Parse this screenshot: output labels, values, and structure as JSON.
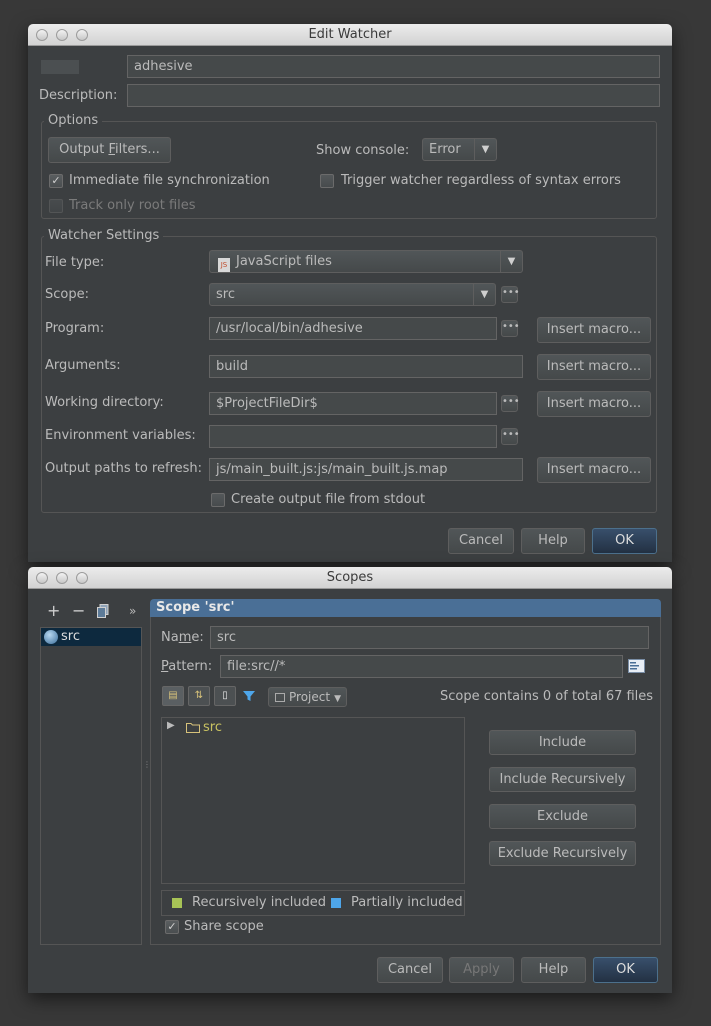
{
  "watcher": {
    "title": "Edit Watcher",
    "name_value": "adhesive",
    "description_label": "Description:",
    "description_value": "",
    "options": {
      "title": "Options",
      "output_filters_pre": "Output ",
      "output_filters_u": "F",
      "output_filters_post": "ilters...",
      "show_console_label": "Show console:",
      "show_console_value": "Error",
      "immediate_sync_label": "Immediate file synchronization",
      "trigger_label": "Trigger watcher regardless of syntax errors",
      "track_root_label": "Track only root files"
    },
    "settings": {
      "title": "Watcher Settings",
      "file_type_label": "File type:",
      "file_type_value": "JavaScript files",
      "file_type_icon_text": "JS",
      "scope_label": "Scope:",
      "scope_value": "src",
      "program_label": "Program:",
      "program_value": "/usr/local/bin/adhesive",
      "arguments_label": "Arguments:",
      "arguments_value": "build",
      "working_dir_label": "Working directory:",
      "working_dir_value": "$ProjectFileDir$",
      "env_label": "Environment variables:",
      "env_value": "",
      "output_paths_label": "Output paths to refresh:",
      "output_paths_value": "js/main_built.js:js/main_built.js.map",
      "insert_macro_label": "Insert macro...",
      "create_output_label": "Create output file from stdout",
      "dots": "•••"
    },
    "buttons": {
      "cancel": "Cancel",
      "help": "Help",
      "ok": "OK"
    }
  },
  "scopes": {
    "title": "Scopes",
    "toolbar": {
      "add": "+",
      "remove": "−",
      "more": "»"
    },
    "scope_list": [
      "src"
    ],
    "scope_header": "Scope 'src'",
    "name_label_pre": "Na",
    "name_label_u": "m",
    "name_label_post": "e:",
    "name_value": "src",
    "pattern_label_u": "P",
    "pattern_label_post": "attern:",
    "pattern_value": "file:src//*",
    "project_dropdown": "Project",
    "scope_info": "Scope contains 0 of total 67 files",
    "tree_item": "src",
    "include": "Include",
    "include_recursively": "Include Recursively",
    "exclude": "Exclude",
    "exclude_recursively": "Exclude Recursively",
    "legend": {
      "recursive": "Recursively included",
      "partial": "Partially included",
      "recursive_color": "#a7c356",
      "partial_color": "#4ea6ea"
    },
    "share_scope": "Share scope",
    "buttons": {
      "cancel": "Cancel",
      "apply": "Apply",
      "help": "Help",
      "ok": "OK"
    }
  }
}
